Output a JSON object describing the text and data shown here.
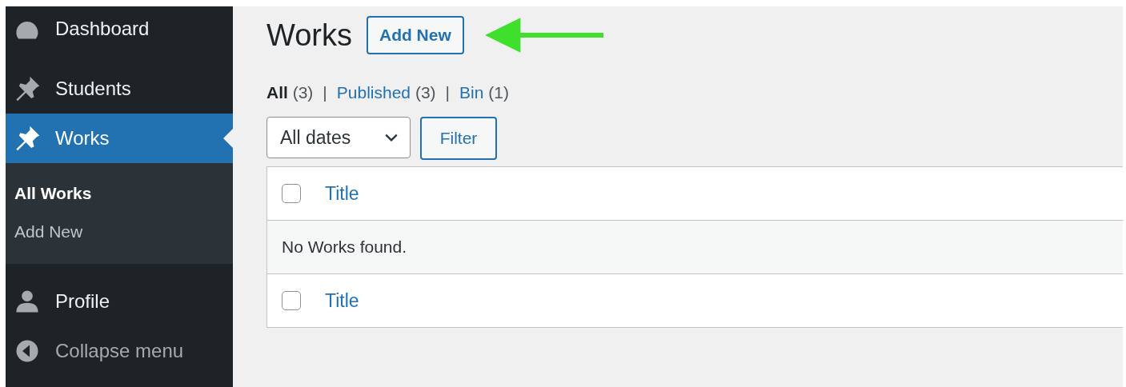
{
  "sidebar": {
    "items": [
      {
        "label": "Dashboard",
        "selected": false
      },
      {
        "label": "Students",
        "selected": false
      },
      {
        "label": "Works",
        "selected": true,
        "children": [
          {
            "label": "All Works",
            "selected": true
          },
          {
            "label": "Add New",
            "selected": false
          }
        ]
      },
      {
        "label": "Profile",
        "selected": false
      }
    ],
    "collapse": "Collapse menu"
  },
  "page": {
    "title": "Works",
    "add_button": "Add New",
    "views": [
      {
        "label": "All",
        "count": "(3)",
        "selected": true
      },
      {
        "separator": "|",
        "label": "Published",
        "count": "(3)",
        "selected": false
      },
      {
        "separator": "|",
        "label": "Bin",
        "count": "(1)",
        "selected": false
      }
    ],
    "date_filter": "All dates",
    "filter_button": "Filter",
    "table": {
      "header": {
        "column": "Title",
        "checked": false
      },
      "empty_message": "No Works found.",
      "footer": {
        "column": "Title",
        "checked": false
      }
    }
  }
}
